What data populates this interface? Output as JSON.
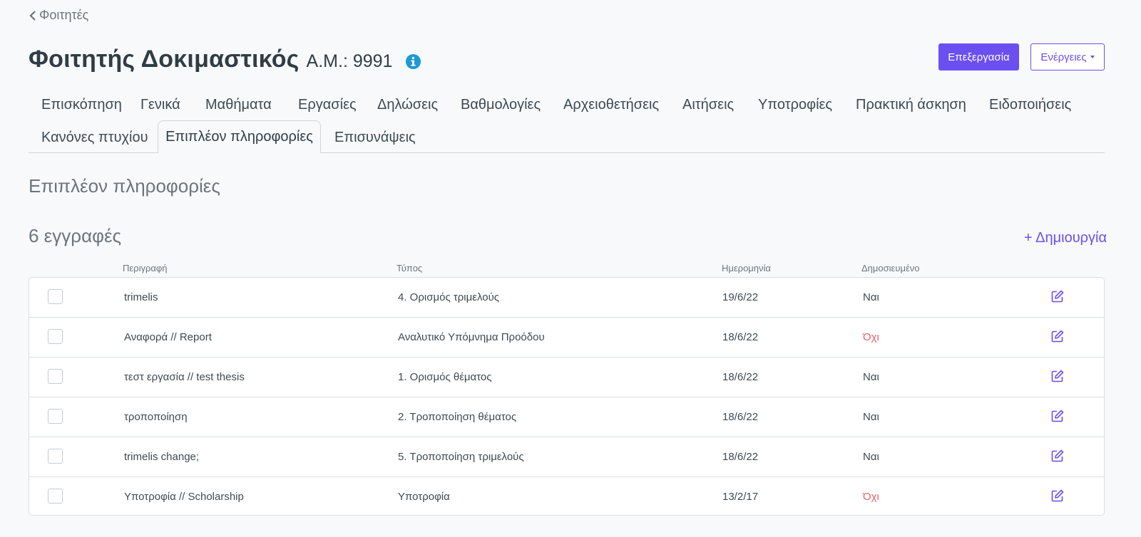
{
  "breadcrumb": {
    "label": "Φοιτητές"
  },
  "header": {
    "name": "Φοιτητής Δοκιμαστικός",
    "student_id": "Α.Μ.: 9991",
    "edit_label": "Επεξεργασία",
    "actions_label": "Ενέργειες"
  },
  "tabs": [
    "Επισκόπηση",
    "Γενικά",
    "Μαθήματα",
    "Εργασίες",
    "Δηλώσεις",
    "Βαθμολογίες",
    "Αρχειοθετήσεις",
    "Αιτήσεις",
    "Υποτροφίες",
    "Πρακτική άσκηση",
    "Ειδοποιήσεις",
    "Κανόνες πτυχίου",
    "Επιπλέον πληροφορίες",
    "Επισυνάψεις"
  ],
  "active_tab": "Επιπλέον πληροφορίες",
  "section_title": "Επιπλέον πληροφορίες",
  "records_count": "6 εγγραφές",
  "create_label": "+ Δημιουργία",
  "table": {
    "headers": [
      "Περιγραφή",
      "Τύπος",
      "Ημερομηνία",
      "Δημοσιευμένο"
    ],
    "rows": [
      {
        "description": "trimelis",
        "type": "4. Ορισμός τριμελούς",
        "date": "19/6/22",
        "published": "Ναι"
      },
      {
        "description": "Αναφορά // Report",
        "type": "Αναλυτικό Υπόμνημα Προόδου",
        "date": "18/6/22",
        "published": "Όχι"
      },
      {
        "description": "τεστ εργασία // test thesis",
        "type": "1. Ορισμός θέματος",
        "date": "18/6/22",
        "published": "Ναι"
      },
      {
        "description": "τροποποίηση",
        "type": "2. Τροποποίηση θέματος",
        "date": "18/6/22",
        "published": "Ναι"
      },
      {
        "description": "trimelis change;",
        "type": "5. Τροποποίηση τριμελούς",
        "date": "18/6/22",
        "published": "Ναι"
      },
      {
        "description": "Υποτροφία // Scholarship",
        "type": "Υποτροφία",
        "date": "13/2/17",
        "published": "Όχι"
      }
    ]
  },
  "colors": {
    "accent": "#6c4ff0",
    "info": "#1d9ad6",
    "negative": "#e86168"
  },
  "icons": {
    "back": "chevron-left-icon",
    "info": "info-icon",
    "edit": "edit-icon"
  }
}
